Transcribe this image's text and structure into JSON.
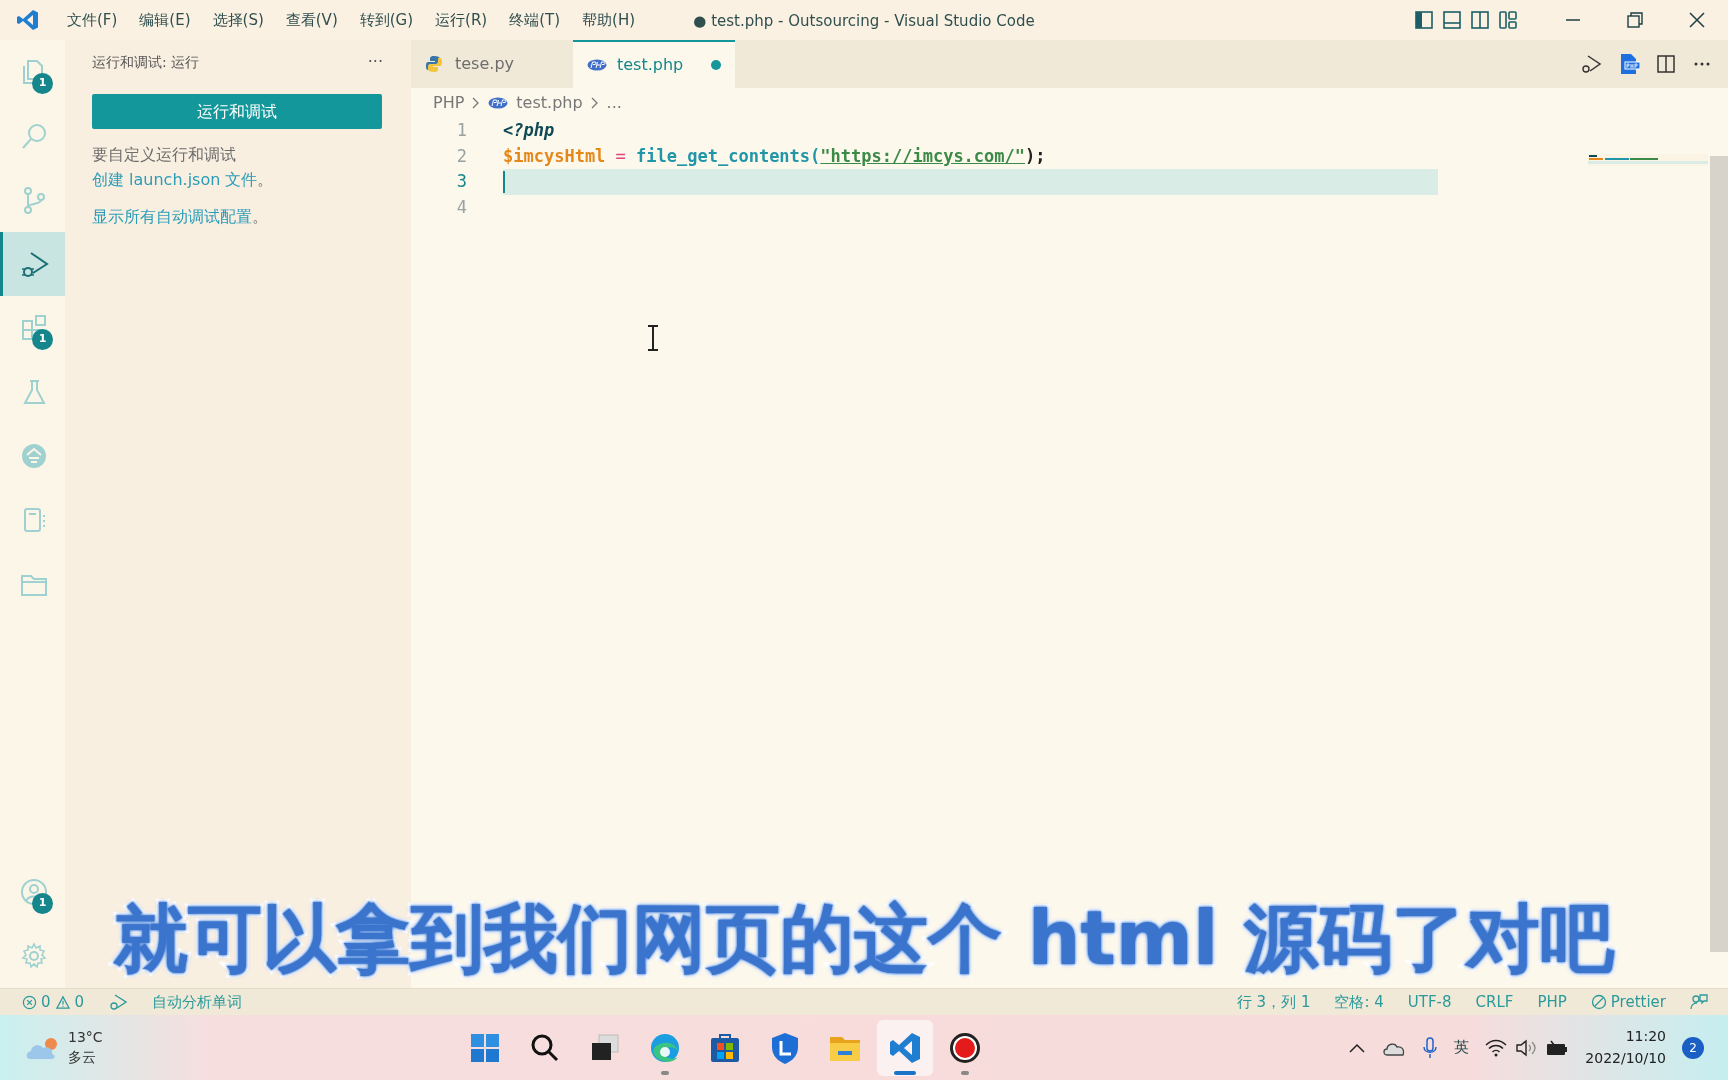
{
  "window": {
    "title": "● test.php - Outsourcing - Visual Studio Code"
  },
  "menu": [
    "文件(F)",
    "编辑(E)",
    "选择(S)",
    "查看(V)",
    "转到(G)",
    "运行(R)",
    "终端(T)",
    "帮助(H)"
  ],
  "activity_bar": [
    {
      "selected": false,
      "badge": "1"
    },
    {
      "selected": false
    },
    {
      "selected": false
    },
    {
      "selected": true
    },
    {
      "selected": false,
      "badge": "1"
    },
    {
      "selected": false
    },
    {
      "selected": false
    },
    {
      "selected": false
    },
    {
      "selected": false
    }
  ],
  "activity_bar_bottom": [
    {
      "selected": false,
      "badge": "1"
    },
    {
      "selected": false
    }
  ],
  "sidebar": {
    "title": "运行和调试: 运行",
    "more": "···",
    "button": "运行和调试",
    "hint": {
      "before": "要自定义运行和调试",
      "link": "创建 launch.json 文件",
      "after": "。"
    },
    "hint2": {
      "link": "显示所有自动调试配置",
      "after": "。"
    }
  },
  "tabs": [
    {
      "label": "tese.py",
      "kind": "python",
      "selected": false,
      "modified": false
    },
    {
      "label": "test.php",
      "kind": "php",
      "selected": true,
      "modified": true
    }
  ],
  "breadcrumb": [
    "PHP",
    "test.php",
    "..."
  ],
  "code": [
    {
      "number": "1",
      "current": false,
      "tokens": [
        {
          "kind": "keyword",
          "text": "<?php"
        }
      ]
    },
    {
      "number": "2",
      "current": false,
      "tokens": [
        {
          "kind": "variable",
          "text": "$imcysHtml"
        },
        {
          "kind": "operator",
          "text": " = "
        },
        {
          "kind": "function",
          "text": "file_get_contents"
        },
        {
          "kind": "punct",
          "text": "("
        },
        {
          "kind": "string",
          "text": "\"https://imcys.com/\"",
          "link": true
        },
        {
          "kind": "plain",
          "text": ");"
        }
      ]
    },
    {
      "number": "3",
      "current": true
    },
    {
      "number": "4",
      "current": false
    }
  ],
  "subtitle": "就可以拿到我们网页的这个 html 源码了对吧",
  "status_bar": {
    "errors": "0",
    "warnings": "0",
    "left_text": "自动分析单词",
    "right": [
      "行 3，列 1",
      "空格: 4",
      "UTF-8",
      "CRLF",
      "PHP",
      "Prettier"
    ]
  },
  "taskbar": {
    "weather": {
      "temperature": "13°C",
      "condition": "多云"
    },
    "apps": [
      {
        "kind": "start",
        "open": false,
        "selected": false
      },
      {
        "kind": "search",
        "open": false,
        "selected": false
      },
      {
        "kind": "taskview",
        "open": false,
        "selected": false
      },
      {
        "kind": "edge",
        "open": true,
        "selected": false
      },
      {
        "kind": "store",
        "open": false,
        "selected": false
      },
      {
        "kind": "shield",
        "open": false,
        "selected": false
      },
      {
        "kind": "folder",
        "open": false,
        "selected": false
      },
      {
        "kind": "vscode",
        "open": true,
        "selected": true
      },
      {
        "kind": "record",
        "open": true,
        "selected": false
      }
    ],
    "language": "英",
    "time": "11:20",
    "date": "2022/10/10",
    "notifications": "2"
  }
}
